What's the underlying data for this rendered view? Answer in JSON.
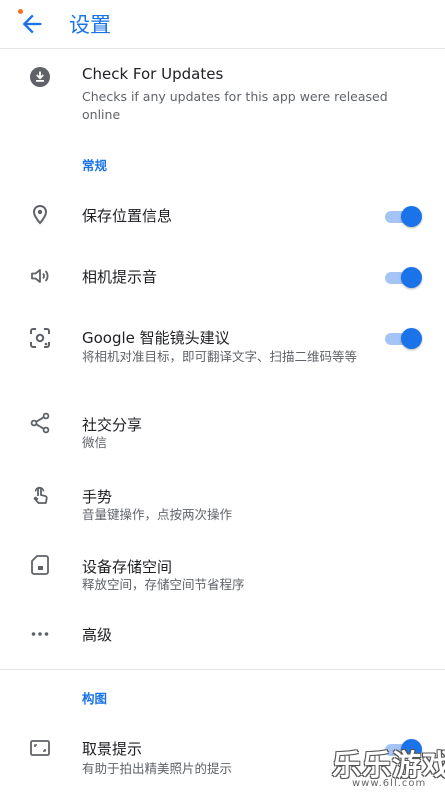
{
  "app_bar": {
    "title": "设置",
    "back_icon": "arrow-back-icon",
    "notification_dot_color": "#f4731c"
  },
  "accent_color": "#1a73e8",
  "items": {
    "updates": {
      "title": "Check For Updates",
      "subtitle": "Checks if any updates for this app were released online",
      "icon": "download-icon"
    },
    "location": {
      "title": "保存位置信息",
      "icon": "location-pin-icon",
      "toggle_on": true
    },
    "shutter_sound": {
      "title": "相机提示音",
      "icon": "volume-icon",
      "toggle_on": true
    },
    "lens": {
      "title": "Google 智能镜头建议",
      "subtitle": "将相机对准目标，即可翻译文字、扫描二维码等等",
      "icon": "google-lens-icon",
      "toggle_on": true
    },
    "social": {
      "title": "社交分享",
      "subtitle": "微信",
      "icon": "share-icon"
    },
    "gestures": {
      "title": "手势",
      "subtitle": "音量键操作，点按两次操作",
      "icon": "gesture-icon"
    },
    "storage": {
      "title": "设备存储空间",
      "subtitle": "释放空间，存储空间节省程序",
      "icon": "sd-card-icon"
    },
    "advanced": {
      "title": "高级",
      "icon": "more-horiz-icon"
    },
    "framing": {
      "title": "取景提示",
      "subtitle": "有助于拍出精美照片的提示",
      "icon": "framing-icon",
      "toggle_on": true
    }
  },
  "sections": {
    "general": "常规",
    "composition": "构图"
  },
  "watermark": {
    "text": "乐乐游戏",
    "url": "www.6ll.com"
  }
}
